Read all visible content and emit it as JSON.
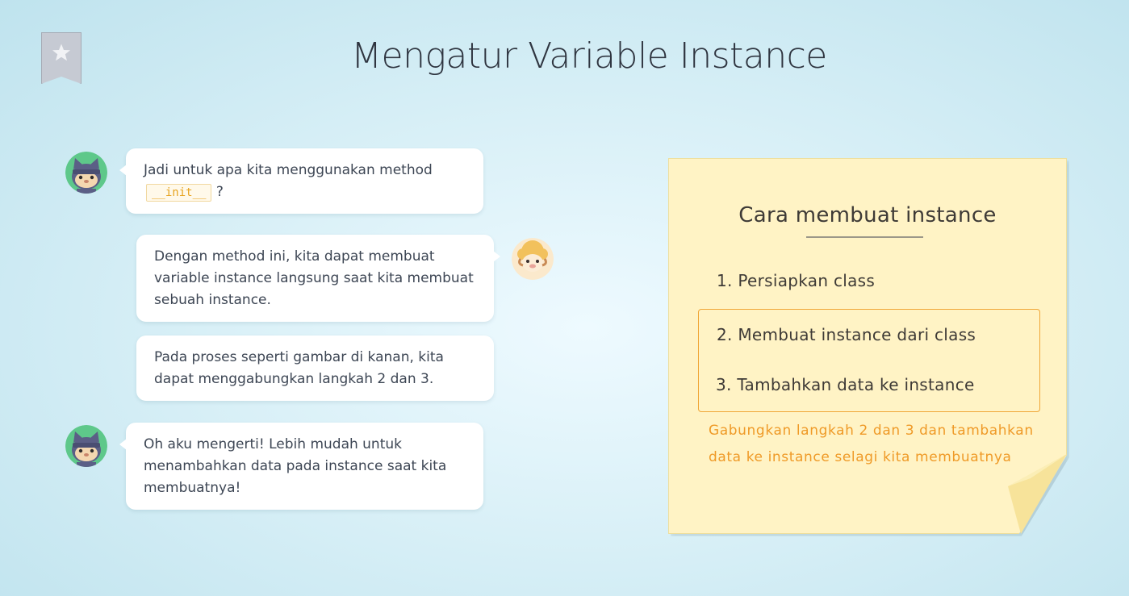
{
  "page": {
    "title": "Mengatur Variable Instance"
  },
  "icons": {
    "bookmark": "bookmark-star-icon",
    "cat_avatar": "ninja-cat-avatar-icon",
    "sheep_avatar": "sheep-avatar-icon"
  },
  "chat": {
    "msg1": {
      "text": "Jadi untuk apa kita menggunakan method",
      "code": "__init__",
      "suffix": "?"
    },
    "msg2": {
      "text": "Dengan method ini, kita dapat membuat variable instance langsung saat kita membuat sebuah instance."
    },
    "msg3": {
      "text": "Pada proses seperti gambar di kanan, kita dapat menggabungkan langkah 2 dan 3."
    },
    "msg4": {
      "text": "Oh aku mengerti! Lebih mudah untuk menambahkan data pada instance saat kita membuatnya!"
    }
  },
  "note": {
    "title": "Cara membuat instance",
    "steps": [
      "1. Persiapkan class",
      "2. Membuat instance dari class",
      "3. Tambahkan data ke instance"
    ],
    "caption": "Gabungkan langkah 2 dan 3 dan tambahkan data ke instance selagi kita membuatnya"
  },
  "colors": {
    "accent_orange": "#ef9a27",
    "code_text": "#e7a421",
    "note_bg": "#fff3c5",
    "avatar_green": "#5ec88a"
  }
}
